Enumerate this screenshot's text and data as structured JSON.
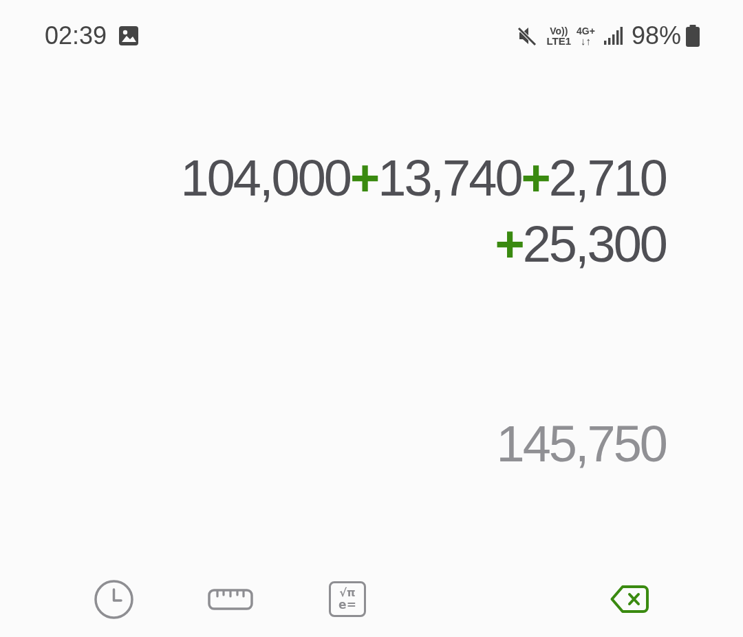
{
  "status_bar": {
    "time": "02:39",
    "volte": "Vo))",
    "lte": "LTE1",
    "network": "4G+",
    "data_arrows": "↓↑",
    "battery": "98%"
  },
  "expression": {
    "lines": [
      [
        {
          "kind": "number",
          "text": "104,000"
        },
        {
          "kind": "operator",
          "text": "+"
        },
        {
          "kind": "number",
          "text": "13,740"
        },
        {
          "kind": "operator",
          "text": "+"
        },
        {
          "kind": "number",
          "text": "2,710"
        }
      ],
      [
        {
          "kind": "operator",
          "text": "+"
        },
        {
          "kind": "number",
          "text": "25,300"
        }
      ]
    ]
  },
  "result": "145,750",
  "toolbar": [
    {
      "kind": "history"
    },
    {
      "kind": "converter"
    },
    {
      "kind": "scientific",
      "symbols": [
        "√π",
        "e="
      ]
    },
    {
      "kind": "backspace"
    }
  ]
}
